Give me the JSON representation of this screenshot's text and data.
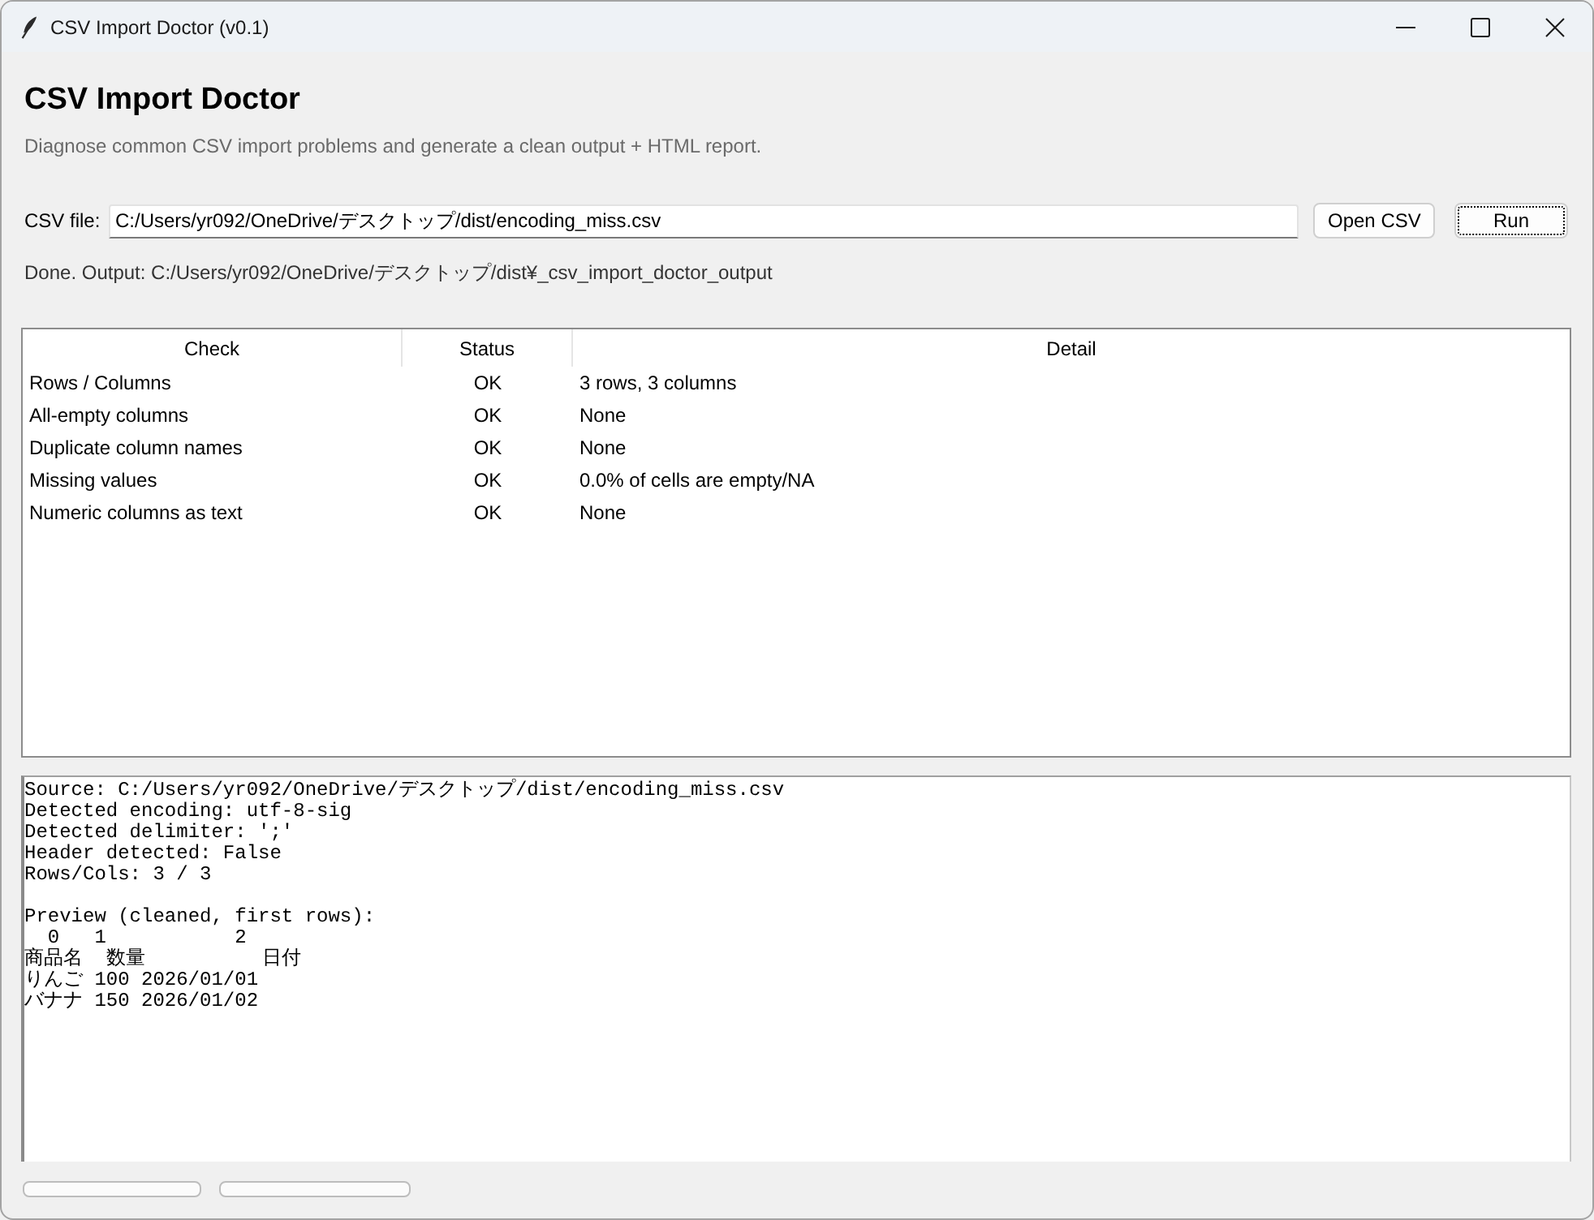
{
  "window": {
    "title": "CSV Import Doctor (v0.1)"
  },
  "header": {
    "title": "CSV Import Doctor",
    "subtitle": "Diagnose common CSV import problems and generate a clean output + HTML report."
  },
  "file_row": {
    "label": "CSV file:",
    "value": "C:/Users/yr092/OneDrive/デスクトップ/dist/encoding_miss.csv",
    "buttons": [
      {
        "label": "Open CSV",
        "focused": false
      },
      {
        "label": "Run",
        "focused": true
      }
    ]
  },
  "status": "Done. Output: C:/Users/yr092/OneDrive/デスクトップ/dist¥_csv_import_doctor_output",
  "table": {
    "columns": [
      "Check",
      "Status",
      "Detail"
    ],
    "rows": [
      {
        "check": "Rows / Columns",
        "status": "OK",
        "detail": "3 rows, 3 columns"
      },
      {
        "check": "All-empty columns",
        "status": "OK",
        "detail": "None"
      },
      {
        "check": "Duplicate column names",
        "status": "OK",
        "detail": "None"
      },
      {
        "check": "Missing values",
        "status": "OK",
        "detail": "0.0% of cells are empty/NA"
      },
      {
        "check": "Numeric columns as text",
        "status": "OK",
        "detail": "None"
      }
    ]
  },
  "log": {
    "blocks": [
      [
        "Source: C:/Users/yr092/OneDrive/デスクトップ/dist/encoding_miss.csv",
        "Detected encoding: utf-8-sig",
        "Detected delimiter: ';'",
        "Header detected: False",
        "Rows/Cols: 3 / 3"
      ],
      [
        "Preview (cleaned, first rows):",
        "  0   1           2",
        "商品名  数量          日付",
        "りんご 100 2026/01/01",
        "バナナ 150 2026/01/02"
      ]
    ]
  }
}
